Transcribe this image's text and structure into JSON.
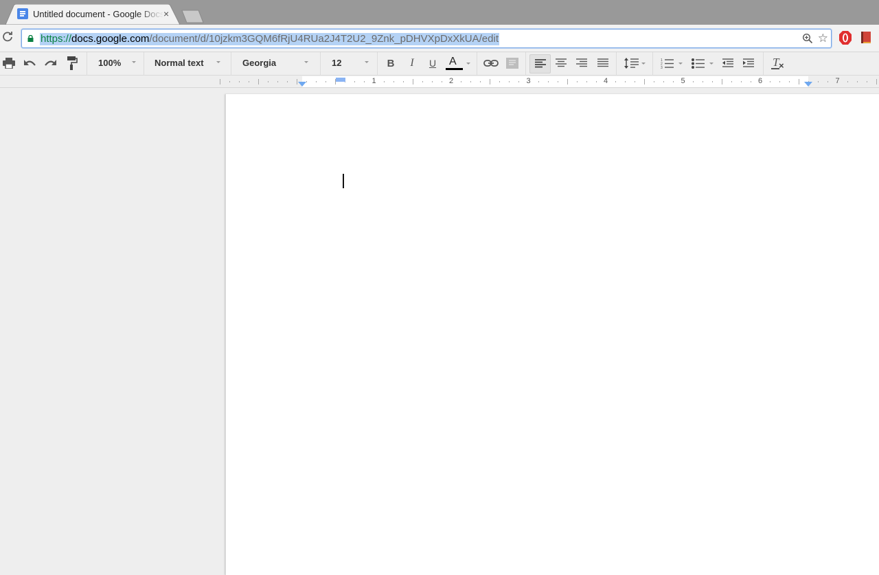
{
  "browser": {
    "tab": {
      "title": "Untitled document - Google Docs",
      "close_symbol": "×"
    },
    "omnibox": {
      "url_scheme": "https://",
      "url_host": "docs.google.com",
      "url_path": "/document/d/10jzkm3GQM6fRjU4RUa2J4T2U2_9Znk_pDHVXpDxXkUA/edit",
      "secure": true
    },
    "reload_symbol": "C",
    "star_symbol": "☆",
    "extensions": [
      "opera-stop-icon",
      "book-icon"
    ]
  },
  "toolbar": {
    "zoom": "100%",
    "style": "Normal text",
    "font": "Georgia",
    "font_size": "12",
    "bold_label": "B",
    "italic_label": "I",
    "underline_label": "U",
    "text_color_label": "A",
    "text_color": "#000000",
    "clear_format_label": "T",
    "alignment_active": "left",
    "icons": [
      "print-icon",
      "undo-icon",
      "redo-icon",
      "paint-format-icon",
      "link-icon",
      "comment-icon",
      "align-left-icon",
      "align-center-icon",
      "align-right-icon",
      "align-justify-icon",
      "line-spacing-icon",
      "numbered-list-icon",
      "bulleted-list-icon",
      "decrease-indent-icon",
      "increase-indent-icon",
      "clear-formatting-icon"
    ]
  },
  "ruler": {
    "numbers": [
      "1",
      "2",
      "3",
      "4",
      "5",
      "6",
      "7"
    ],
    "left_margin_in": 1,
    "right_margin_in": 7.5
  },
  "document": {
    "content": ""
  }
}
